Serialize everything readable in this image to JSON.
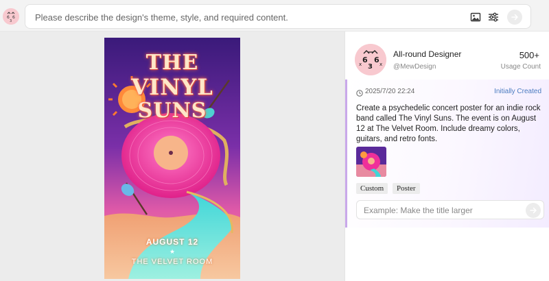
{
  "topbar": {
    "prompt_placeholder": "Please describe the design's theme, style, and required content.",
    "icons": [
      "image-upload-icon",
      "settings-sliders-icon",
      "send-arrow-icon"
    ]
  },
  "poster": {
    "title_line1": "THE",
    "title_line2": "VINYL",
    "title_line3": "SUNS",
    "date": "AUGUST 12",
    "separator": "★",
    "venue": "THE VELVET ROOM"
  },
  "profile": {
    "name": "All-round Designer",
    "handle": "@MewDesign",
    "usage_count": "500+",
    "usage_label": "Usage Count"
  },
  "history_card": {
    "timestamp": "2025/7/20 22:24",
    "status": "Initially Created",
    "prompt_text": "Create a psychedelic concert poster for an indie rock band called The Vinyl Suns. The event is on August 12 at The Velvet Room. Include dreamy colors, guitars, and retro fonts.",
    "tags": [
      "Custom",
      "Poster"
    ],
    "edit_placeholder": "Example: Make the title larger"
  },
  "colors": {
    "accent_link": "#4a7bc0",
    "card_border": "#c9a8ea",
    "avatar_bg": "#f8c9cf",
    "canvas_bg": "#ececec"
  }
}
